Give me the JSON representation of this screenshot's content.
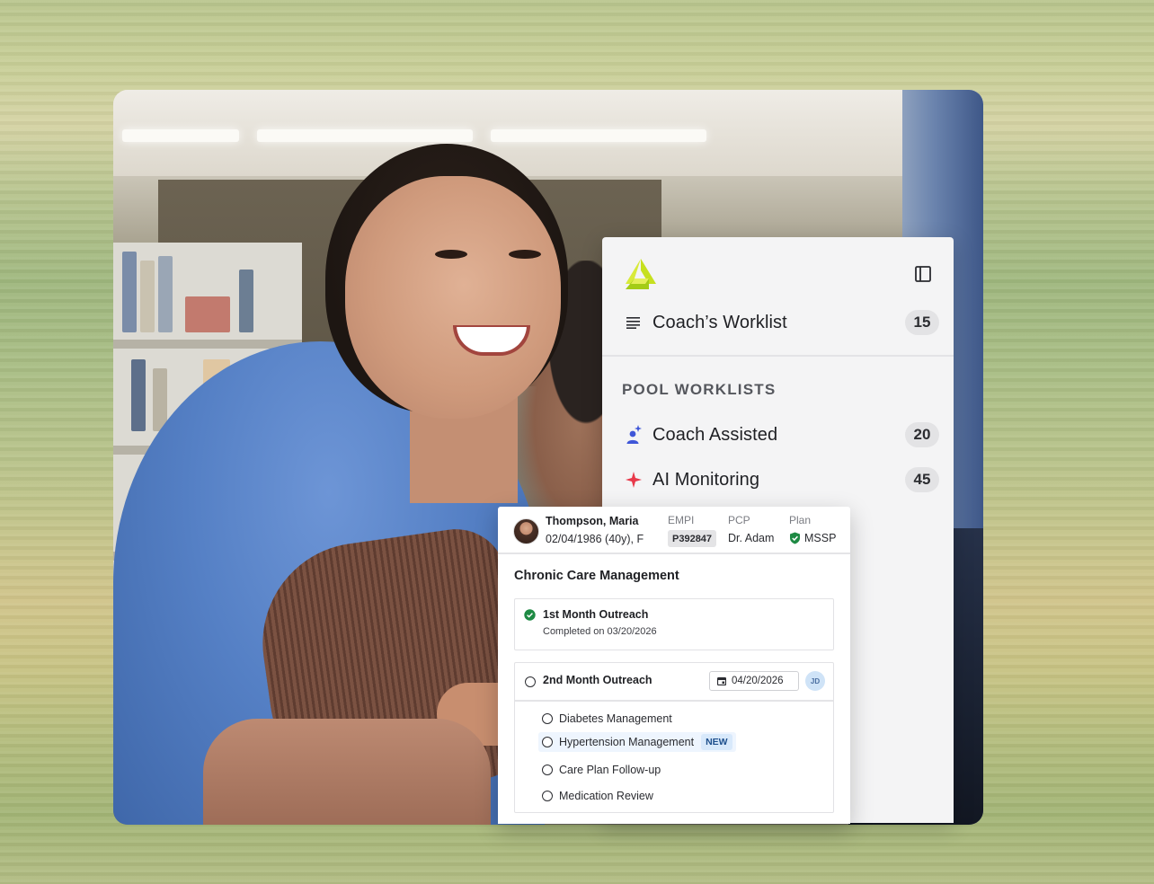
{
  "sidebar": {
    "coach_worklist": {
      "label": "Coach’s Worklist",
      "count": "15"
    },
    "section_title": "POOL WORKLISTS",
    "items": [
      {
        "label": "Coach Assisted",
        "count": "20",
        "icon": "person-sparkle-icon"
      },
      {
        "label": "AI Monitoring",
        "count": "45",
        "icon": "sparkle-icon"
      }
    ]
  },
  "patient": {
    "name": "Thompson, Maria",
    "dob": "02/04/1986 (40y), F",
    "empi_label": "EMPI",
    "empi": "P392847",
    "pcp_label": "PCP",
    "pcp": "Dr. Adam",
    "plan_label": "Plan",
    "plan": "MSSP"
  },
  "care": {
    "title": "Chronic Care Management",
    "task1": {
      "title": "1st Month Outreach",
      "subtitle": "Completed on 03/20/2026"
    },
    "task2": {
      "title": "2nd Month Outreach",
      "date": "04/20/2026",
      "assignee": "JD",
      "subtasks": [
        {
          "label": "Diabetes Management"
        },
        {
          "label": "Hypertension Management",
          "badge": "NEW"
        },
        {
          "label": "Care Plan Follow-up"
        },
        {
          "label": "Medication Review"
        }
      ]
    }
  },
  "colors": {
    "logo_lime": "#c6e01f",
    "ai_red": "#e8394a",
    "coach_blue": "#3f56d8",
    "success_green": "#1e8a44"
  }
}
